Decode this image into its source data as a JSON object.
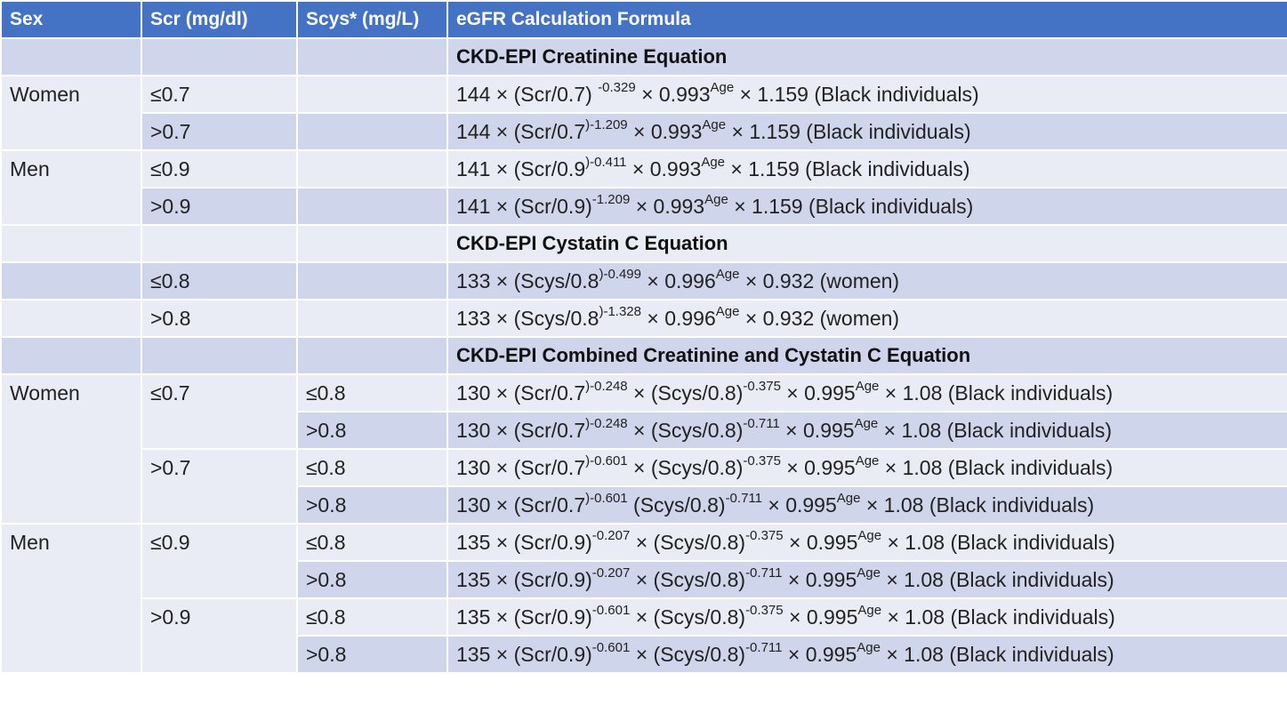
{
  "colors": {
    "header_bg": "#4472c4",
    "row_dark": "#cfd5ea",
    "row_light": "#e9ebf5"
  },
  "headers": [
    "Sex",
    "Scr (mg/dl)",
    "Scys* (mg/L)",
    "eGFR Calculation Formula"
  ],
  "sections": {
    "creatinine": "CKD-EPI Creatinine Equation",
    "cystatin": "CKD-EPI Cystatin C Equation",
    "combined": "CKD-EPI Combined Creatinine and Cystatin C Equation"
  },
  "labels": {
    "women": "Women",
    "men": "Men",
    "le07": "≤0.7",
    "gt07": ">0.7",
    "le09": "≤0.9",
    "gt09": ">0.9",
    "le08": "≤0.8",
    "gt08": ">0.8"
  },
  "formulas": {
    "cr_w_le": [
      "144 × (Scr/0.7) ",
      "-0.329",
      " × 0.993",
      "Age",
      " × 1.159 (Black individuals)"
    ],
    "cr_w_gt": [
      "144 × (Scr/0.7",
      ")-1.209",
      " × 0.993",
      "Age",
      " × 1.159 (Black individuals)"
    ],
    "cr_m_le": [
      "141 × (Scr/0.9",
      ")-0.411",
      " × 0.993",
      "Age",
      " × 1.159 (Black individuals)"
    ],
    "cr_m_gt": [
      "141 × (Scr/0.9)",
      "-1.209",
      " × 0.993",
      "Age",
      " × 1.159 (Black individuals)"
    ],
    "cy_le": [
      "133 × (Scys/0.8",
      ")-0.499",
      " × 0.996",
      "Age",
      " × 0.932 (women)"
    ],
    "cy_gt": [
      "133 × (Scys/0.8",
      ")-1.328",
      " × 0.996",
      "Age",
      " × 0.932 (women)"
    ],
    "co_w_le_le": [
      "130 × (Scr/0.7",
      ")-0.248",
      " × (Scys/0.8)",
      "-0.375",
      " × 0.995",
      "Age",
      " × 1.08 (Black individuals)"
    ],
    "co_w_le_gt": [
      "130 × (Scr/0.7",
      ")-0.248",
      " × (Scys/0.8)",
      "-0.711",
      " × 0.995",
      "Age",
      " × 1.08 (Black individuals)"
    ],
    "co_w_gt_le": [
      "130 × (Scr/0.7",
      ")-0.601",
      " × (Scys/0.8)",
      "-0.375",
      " × 0.995",
      "Age",
      " × 1.08 (Black individuals)"
    ],
    "co_w_gt_gt": [
      "130 × (Scr/0.7",
      ")-0.601",
      " (Scys/0.8)",
      "-0.711",
      " × 0.995",
      "Age",
      " × 1.08 (Black individuals)"
    ],
    "co_m_le_le": [
      "135 × (Scr/0.9)",
      "-0.207",
      " × (Scys/0.8)",
      "-0.375",
      " × 0.995",
      "Age",
      " × 1.08 (Black individuals)"
    ],
    "co_m_le_gt": [
      "135 × (Scr/0.9)",
      "-0.207",
      " × (Scys/0.8)",
      "-0.711",
      " × 0.995",
      "Age",
      " × 1.08 (Black individuals)"
    ],
    "co_m_gt_le": [
      "135 × (Scr/0.9)",
      "-0.601",
      " × (Scys/0.8)",
      "-0.375",
      " × 0.995",
      "Age",
      " × 1.08 (Black individuals)"
    ],
    "co_m_gt_gt": [
      "135 × (Scr/0.9)",
      "-0.601",
      " × (Scys/0.8)",
      "-0.711",
      " × 0.995",
      "Age",
      " × 1.08 (Black individuals)"
    ]
  }
}
